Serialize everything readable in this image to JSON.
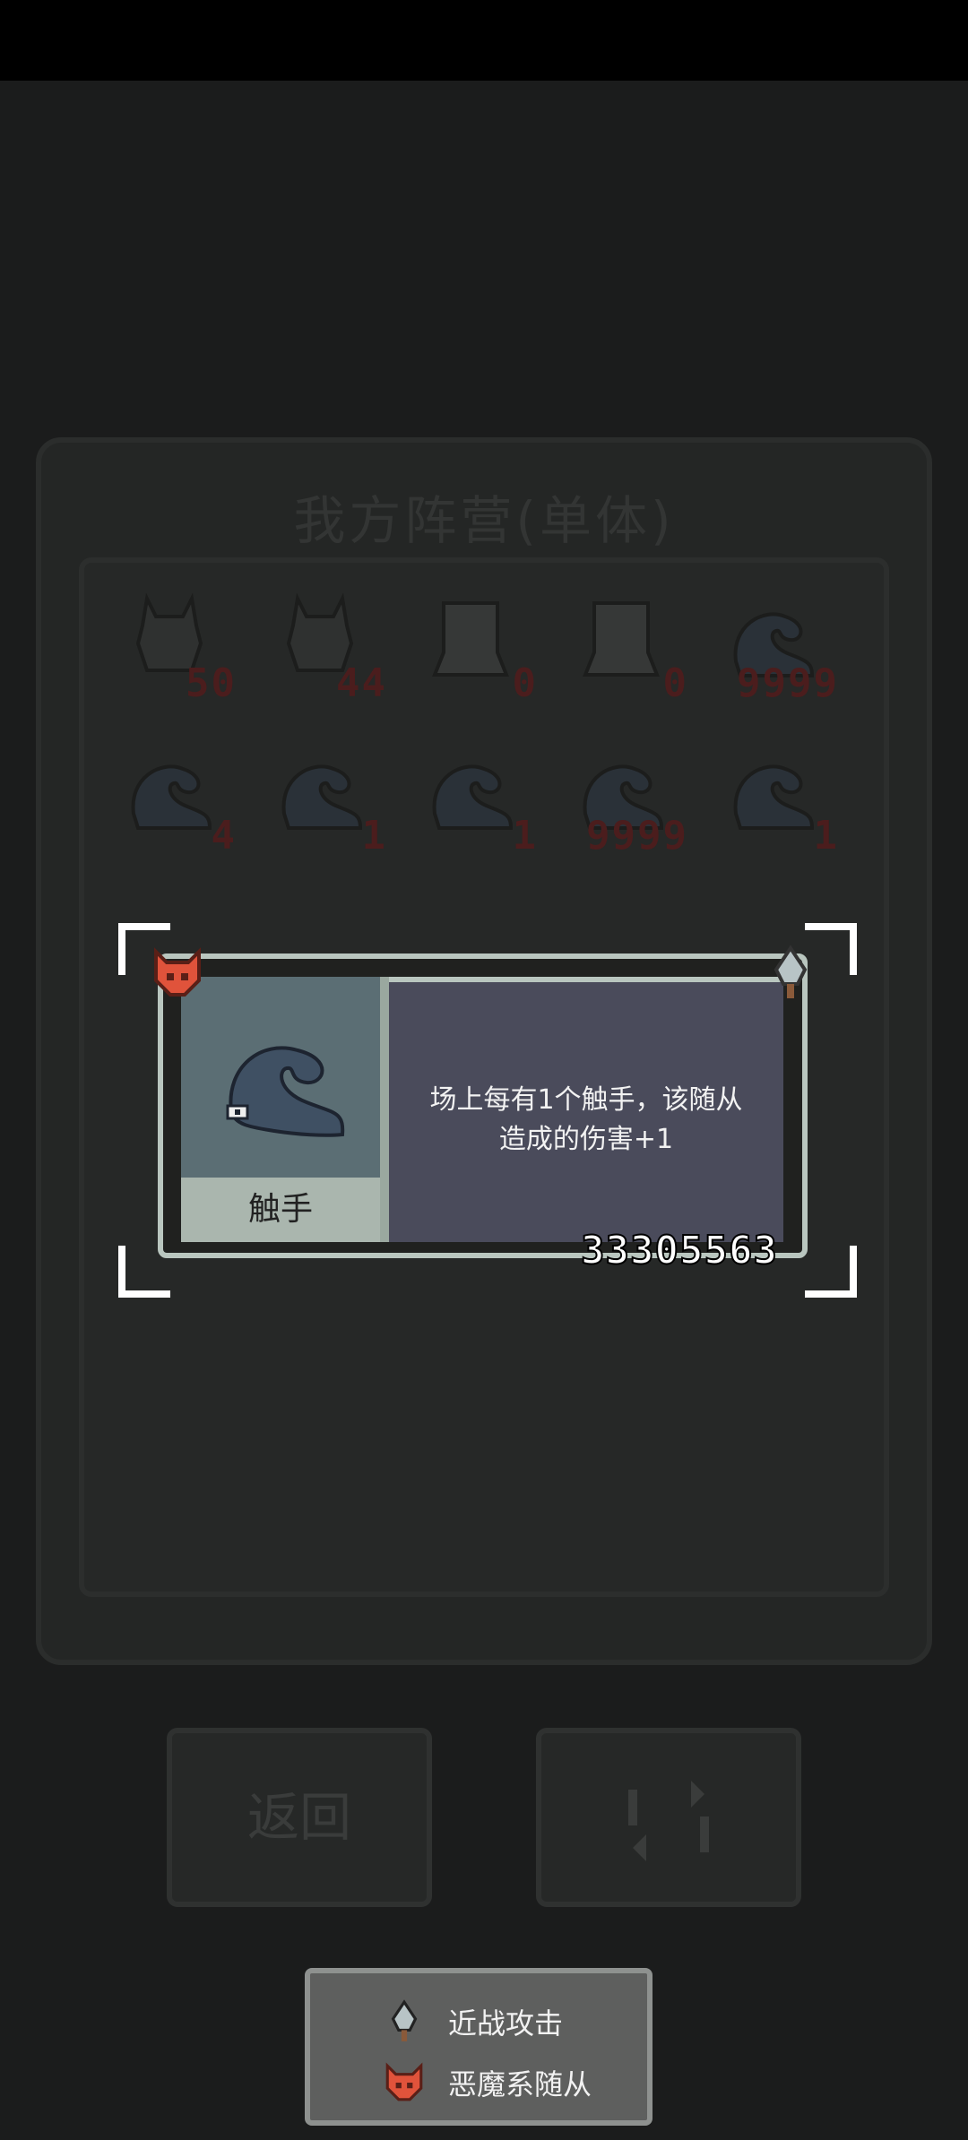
{
  "background": {
    "panel_title": "我方阵营(单体)",
    "units": [
      {
        "type": "rabbit",
        "value": "50"
      },
      {
        "type": "rabbit",
        "value": "44"
      },
      {
        "type": "ghost",
        "value": "0"
      },
      {
        "type": "ghost",
        "value": "0"
      },
      {
        "type": "tentacle",
        "value": "9999"
      },
      {
        "type": "tentacle",
        "value": "4"
      },
      {
        "type": "tentacle",
        "value": "1"
      },
      {
        "type": "tentacle",
        "value": "1"
      },
      {
        "type": "tentacle",
        "value": "9999"
      },
      {
        "type": "tentacle",
        "value": "1"
      }
    ],
    "back_button_label": "返回",
    "refresh_icon": "refresh-icon"
  },
  "tooltip": {
    "name": "触手",
    "description_line1": "场上每有1个触手，该随从",
    "description_line2": "造成的伤害+1",
    "id_number": "33305563",
    "tag_left_icon": "demon-fox-icon",
    "tag_right_icon": "melee-sword-icon"
  },
  "legend": {
    "melee_label": "近战攻击",
    "demon_label": "恶魔系随从"
  },
  "colors": {
    "damage_red": "#4b1d1d",
    "demon_orange": "#e0533b",
    "tentacle_blue": "#3f5063"
  }
}
